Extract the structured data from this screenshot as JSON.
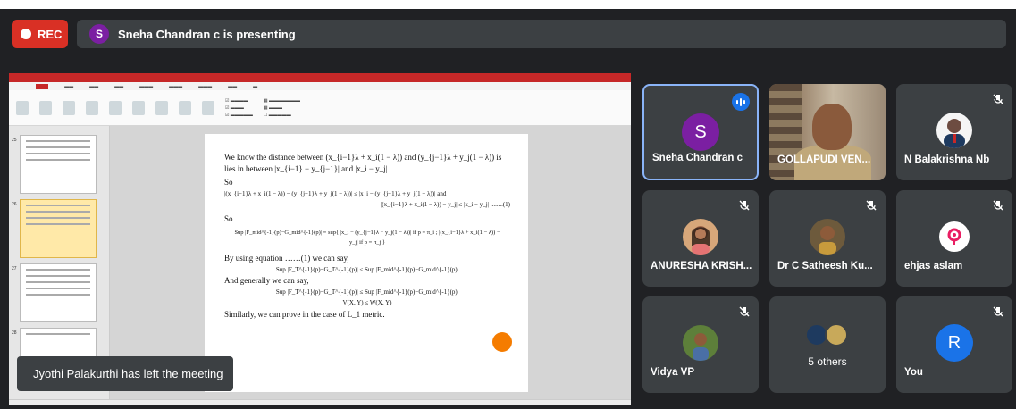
{
  "recording": {
    "label": "REC",
    "color": "#d93025"
  },
  "presenter": {
    "initial": "S",
    "text": "Sneha Chandran c is presenting"
  },
  "slide": {
    "line1": "We know the distance between (x_{i−1}λ + x_i(1 − λ)) and (y_{j−1}λ + y_j(1 − λ)) is",
    "line2": "lies in between |x_{i−1} − y_{j−1}| and |x_i − y_j|",
    "so1": "So",
    "ineq1": "|(x_{i−1}λ + x_i(1 − λ)) − (y_{j−1}λ + y_j(1 − λ))| ≤ |x_i − (y_{j−1}λ + y_j(1 − λ))| and",
    "ineq2": "|(x_{i−1}λ + x_i(1 − λ)) − y_j| ≤ |x_i − y_j| ........(1)",
    "so2": "So",
    "sup": "Sup |F_mid^{-1}(p)−G_mid^{-1}(p)| = sup{ |x_i − (y_{j−1}λ + y_j(1 − λ))| if p = π_i ; |(x_{i−1}λ + x_i(1 − λ)) − y_j| if p = π_j }",
    "using": "By using equation ……(1) we can say,",
    "eq2": "Sup |F_T^{-1}(p)−G_T^{-1}(p)| ≤ Sup |F_mid^{-1}(p)−G_mid^{-1}(p)|",
    "general": "And generally we can say,",
    "eq3": "Sup |F_T^{-1}(p)−G_T^{-1}(p)| ≤ Sup |F_mid^{-1}(p)−G_mid^{-1}(p)|",
    "eq4": "V(X, Y) ≤ W(X, Y)",
    "similarly": "Similarly, we can prove in the case of L_1 metric."
  },
  "toast": "Jyothi Palakurthi has left the meeting",
  "participants": [
    {
      "name": "Sneha Chandran c",
      "initial": "S",
      "color": "#7b1fa2",
      "type": "avatar",
      "speaking": true
    },
    {
      "name": "GOLLAPUDI VEN...",
      "type": "video"
    },
    {
      "name": "N Balakrishna Nb",
      "type": "photo",
      "muted": true
    },
    {
      "name": "ANURESHA KRISH...",
      "type": "photo",
      "muted": true
    },
    {
      "name": "Dr C Satheesh Ku...",
      "type": "photo",
      "muted": true
    },
    {
      "name": "ehjas aslam",
      "type": "photo",
      "muted": true
    },
    {
      "name": "Vidya VP",
      "type": "photo",
      "muted": true
    },
    {
      "name": "5 others",
      "type": "group"
    },
    {
      "name": "You",
      "initial": "R",
      "color": "#1a73e8",
      "type": "avatar",
      "muted": true
    }
  ]
}
